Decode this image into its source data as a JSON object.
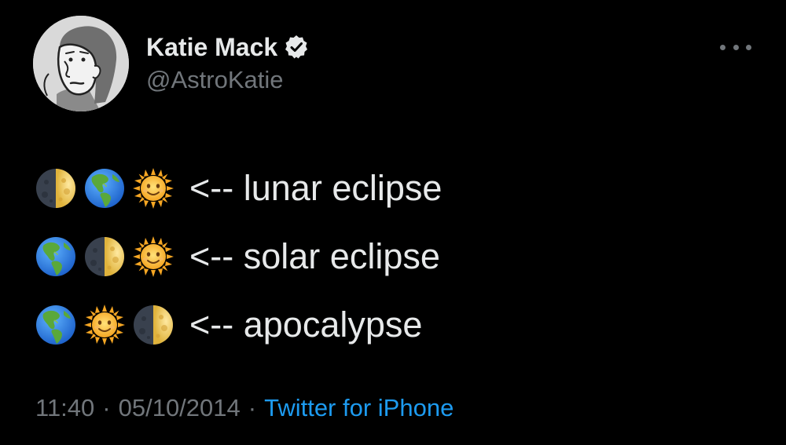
{
  "author": {
    "display_name": "Katie Mack",
    "handle": "@AstroKatie",
    "verified_icon": "verified-badge-icon",
    "avatar_icon": "cartoon-portrait-avatar"
  },
  "more_icon": "more-options-icon",
  "lines": [
    {
      "emojis": [
        "moon-last-quarter",
        "earth-americas",
        "sun-with-face"
      ],
      "text": "<-- lunar eclipse"
    },
    {
      "emojis": [
        "earth-americas",
        "moon-last-quarter",
        "sun-with-face"
      ],
      "text": "<-- solar eclipse"
    },
    {
      "emojis": [
        "earth-americas",
        "sun-with-face",
        "moon-last-quarter"
      ],
      "text": "<-- apocalypse"
    }
  ],
  "meta": {
    "time": "11:40",
    "separator": "·",
    "date": "05/10/2014",
    "source": "Twitter for iPhone"
  },
  "colors": {
    "background": "#000000",
    "text_primary": "#e7e9ea",
    "text_secondary": "#71767b",
    "link": "#1d9bf0"
  }
}
